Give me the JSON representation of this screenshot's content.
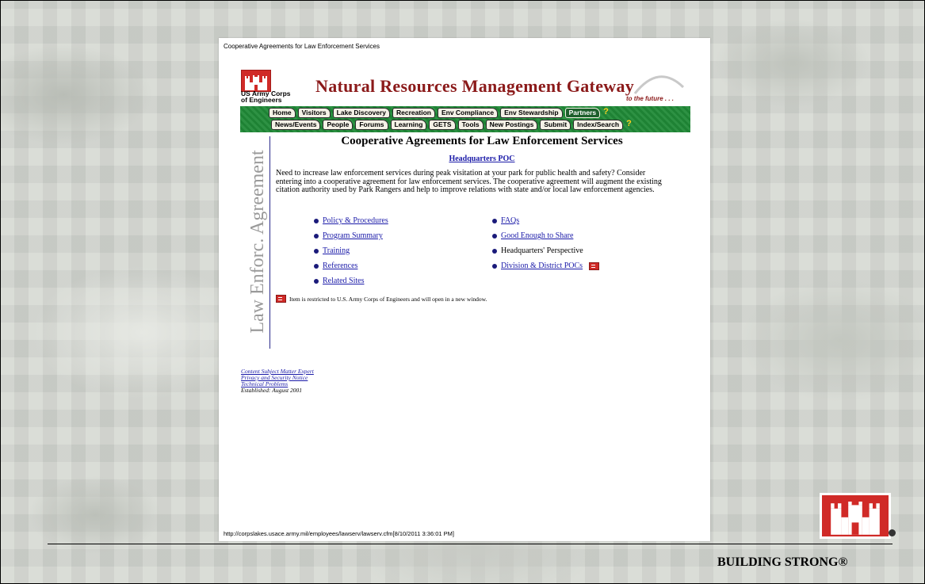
{
  "page": {
    "doc_title": "Cooperative Agreements for Law Enforcement Services",
    "status_url": "http://corpslakes.usace.army.mil/employees/lawserv/lawserv.cfm[8/10/2011 3:36:01 PM]"
  },
  "header": {
    "org_line1": "US Army Corps",
    "org_line2": "of Engineers",
    "gateway_title": "Natural Resources Management Gateway",
    "tagline": "to the future . . ."
  },
  "nav": {
    "row1": [
      "Home",
      "Visitors",
      "Lake Discovery",
      "Recreation",
      "Env Compliance",
      "Env Stewardship",
      "Partners"
    ],
    "row2": [
      "News/Events",
      "People",
      "Forums",
      "Learning",
      "GETS",
      "Tools",
      "New Postings",
      "Submit",
      "Index/Search"
    ],
    "help_symbol": "?"
  },
  "side_banner": "Law Enforc. Agreement",
  "content": {
    "title": "Cooperative Agreements for Law Enforcement Services",
    "hq_poc": "Headquarters POC",
    "intro": "Need to increase law enforcement services during peak visitation at your park for public health and safety? Consider entering into a cooperative agreement for law enforcement services. The cooperative agreement will augment the existing citation authority used by Park Rangers and help to improve relations with state and/or local law enforcement agencies.",
    "left_links": [
      "Policy & Procedures",
      "Program Summary",
      "Training",
      "References",
      "Related Sites"
    ],
    "right_links": [
      "FAQs",
      "Good Enough to Share",
      "Headquarters' Perspective",
      "Division & District POCs"
    ],
    "restricted_note": "Item is restricted to U.S. Army Corps of Engineers and will open in a new window."
  },
  "footer": {
    "sme": "Content Subject Matter Expert",
    "privacy": "Privacy and Security Notice",
    "tech": "Technical Problems",
    "established": "Established: August 2001"
  },
  "slide": {
    "tagline": "BUILDING STRONG®"
  },
  "colors": {
    "usace_red": "#d02a27",
    "nav_green": "#208a37",
    "title_maroon": "#8b1a1a",
    "link_blue": "#1a1aa8"
  },
  "icons": {
    "logo": "castle-icon",
    "help": "question-icon",
    "restricted": "lock-icon"
  }
}
